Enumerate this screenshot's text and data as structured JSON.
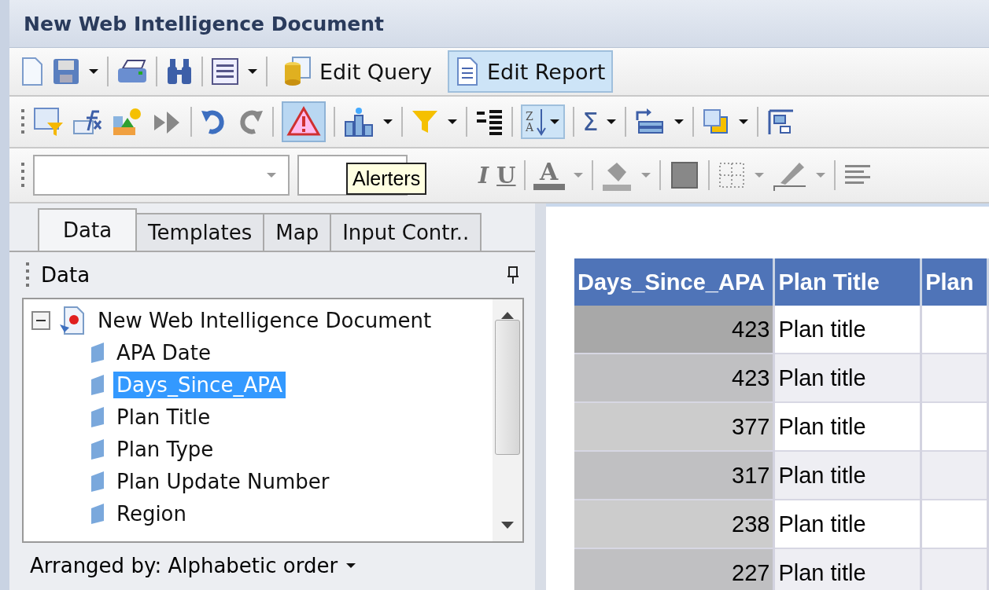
{
  "window": {
    "title": "New Web Intelligence Document"
  },
  "toolbar_main": {
    "buttons": [
      {
        "label": "Edit Query",
        "selected": false
      },
      {
        "label": "Edit Report",
        "selected": true
      }
    ]
  },
  "toolbar_report": {
    "alerters_pressed": true,
    "sort_pressed": true,
    "sort_letters": [
      "Z",
      "A"
    ],
    "sum_glyph": "Σ"
  },
  "toolbar_format": {
    "italic_glyph": "I",
    "underline_glyph": "U",
    "font_color_glyph": "A"
  },
  "tooltip": "Alerters",
  "side_panel": {
    "tabs": [
      {
        "label": "Data",
        "selected": true
      },
      {
        "label": "Templates",
        "selected": false
      },
      {
        "label": "Map",
        "selected": false
      },
      {
        "label": "Input Contr..",
        "selected": false
      }
    ],
    "header": "Data",
    "tree": {
      "label": "New Web Intelligence Document",
      "expanded": true,
      "children": [
        {
          "label": "APA Date",
          "selected": false
        },
        {
          "label": "Days_Since_APA",
          "selected": true
        },
        {
          "label": "Plan Title",
          "selected": false
        },
        {
          "label": "Plan Type",
          "selected": false
        },
        {
          "label": "Plan Update Number",
          "selected": false
        },
        {
          "label": "Region",
          "selected": false
        }
      ]
    },
    "footer": "Arranged by: Alphabetic order"
  },
  "table": {
    "columns": [
      "Days_Since_APA",
      "Plan Title",
      "Plan"
    ],
    "rows": [
      {
        "days": "423",
        "title": "Plan title",
        "selected": true
      },
      {
        "days": "423",
        "title": "Plan title",
        "selected": false
      },
      {
        "days": "377",
        "title": "Plan title",
        "selected": false
      },
      {
        "days": "317",
        "title": "Plan title",
        "selected": false
      },
      {
        "days": "238",
        "title": "Plan title",
        "selected": false
      },
      {
        "days": "227",
        "title": "Plan title",
        "selected": false
      }
    ]
  }
}
